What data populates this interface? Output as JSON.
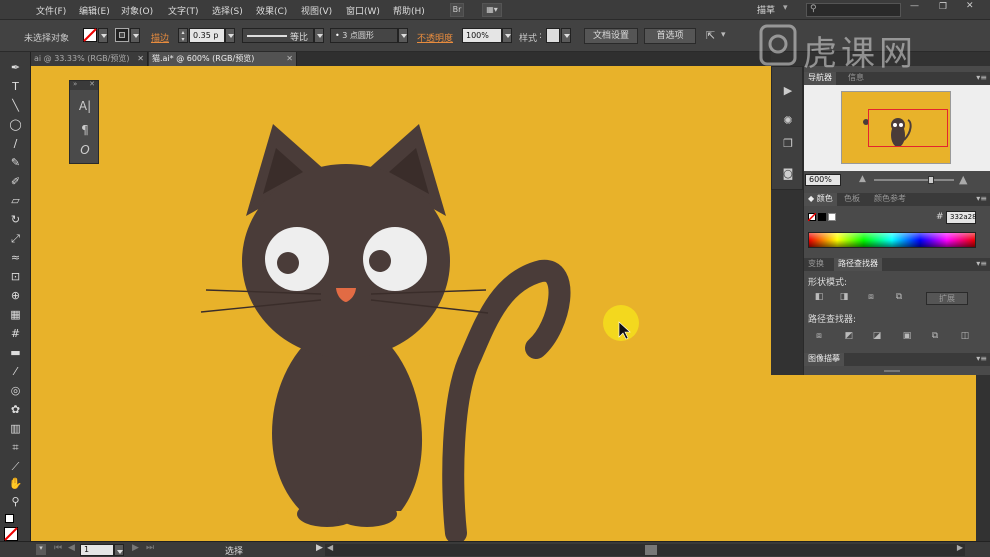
{
  "menubar": {
    "items": [
      "文件(F)",
      "编辑(E)",
      "对象(O)",
      "文字(T)",
      "选择(S)",
      "效果(C)",
      "视图(V)",
      "窗口(W)",
      "帮助(H)"
    ],
    "bridge_label": "Br",
    "workspace": "描草",
    "search_placeholder": ""
  },
  "control_bar": {
    "selection_label": "未选择对象",
    "stroke_label": "描边",
    "stroke_value": "0.35 p",
    "line_style": "等比",
    "brush": "3 点圆形",
    "opacity_label": "不透明度",
    "opacity_value": "100%",
    "style_label": "样式",
    "doc_setup": "文档设置",
    "preferences": "首选项"
  },
  "tabs": [
    {
      "label": "ai @ 33.33% (RGB/预览)",
      "active": false
    },
    {
      "label": "猫.ai* @ 600% (RGB/预览)",
      "active": true
    }
  ],
  "navigator": {
    "tabs": [
      "导航器",
      "信息"
    ],
    "zoom": "600%"
  },
  "color_panel": {
    "tabs": [
      "颜色",
      "色板",
      "颜色参考"
    ],
    "hex_label": "#",
    "hex_value": "332a28"
  },
  "pathfinder": {
    "tabs": [
      "变换",
      "路径查找器"
    ],
    "shape_modes_label": "形状模式:",
    "expand_label": "扩展",
    "pathfinders_label": "路径查找器:"
  },
  "image_trace": {
    "label": "图像描摹"
  },
  "status": {
    "page": "1",
    "tool": "选择"
  },
  "watermark": {
    "text": "虎课网"
  },
  "colors": {
    "canvas": "#e8b22a",
    "cat": "#4a3c39",
    "cursor_highlight": "#f3d81e"
  }
}
